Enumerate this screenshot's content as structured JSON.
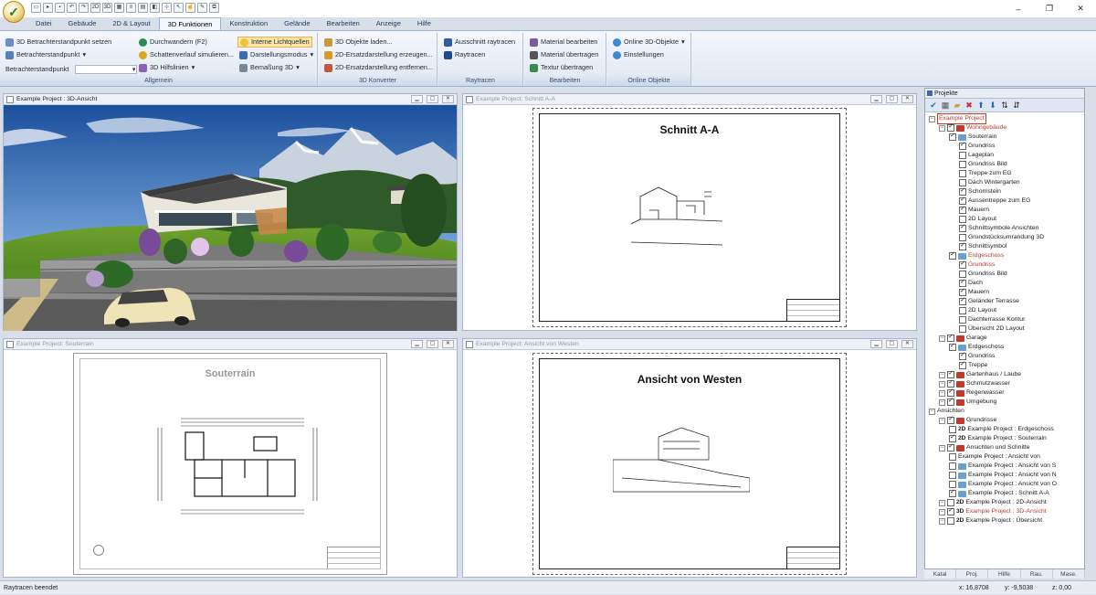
{
  "app": {
    "icon": "app-orb-icon"
  },
  "window_controls": [
    "–",
    "❐",
    "✕"
  ],
  "tabs": [
    "Datei",
    "Gebäude",
    "2D & Layout",
    "3D Funktionen",
    "Konstruktion",
    "Gelände",
    "Bearbeiten",
    "Anzeige",
    "Hilfe"
  ],
  "active_tab": "3D Funktionen",
  "ribbon": {
    "allgemein": {
      "label": "Allgemein",
      "col1": [
        "3D Betrachterstandpunkt setzen",
        "Betrachterstandpunkt",
        "Betrachterstandpunkt"
      ],
      "col2": [
        "Durchwandern (F2)",
        "Schattenverlauf simulieren...",
        "3D Hilfslinien"
      ],
      "col3": [
        "Interne Lichtquellen",
        "Darstellungsmodus",
        "Bemaßung 3D"
      ]
    },
    "konverter": {
      "label": "3D Konverter",
      "items": [
        "3D Objekte laden...",
        "2D-Ersatzdarstellung erzeugen...",
        "2D-Ersatzdarstellung entfernen..."
      ]
    },
    "raytracen": {
      "label": "Raytracen",
      "items": [
        "Ausschnitt raytracen",
        "Raytracen"
      ]
    },
    "bearbeiten": {
      "label": "Bearbeiten",
      "items": [
        "Material bearbeiten",
        "Material übertragen",
        "Textur übertragen"
      ]
    },
    "online": {
      "label": "Online Objekte",
      "items": [
        "Online 3D-Objekte",
        "Einstellungen"
      ]
    }
  },
  "windows": {
    "view3d": {
      "title": "Example Project : 3D-Ansicht"
    },
    "schnitt": {
      "title": "Example Project: Schnitt A-A",
      "sheet_title": "Schnitt A-A"
    },
    "souterrain": {
      "title": "Example Project: Souterrain",
      "sheet_title": "Souterrain"
    },
    "westen": {
      "title": "Example Project: Ansicht von Westen",
      "sheet_title": "Ansicht von Westen"
    }
  },
  "projects": {
    "header": "Projekte",
    "nodes": [
      {
        "label": "Example Project",
        "level": 0,
        "red": true,
        "box": true
      },
      {
        "label": "Wohngebäude",
        "level": 1,
        "red": true,
        "check": true
      },
      {
        "label": "Souterrain",
        "level": 2,
        "check": true
      },
      {
        "label": "Grundriss",
        "level": 3,
        "check": true
      },
      {
        "label": "Lageplan",
        "level": 3,
        "check": false
      },
      {
        "label": "Grundriss Bild",
        "level": 3,
        "check": false
      },
      {
        "label": "Treppe zum EG",
        "level": 3,
        "check": false
      },
      {
        "label": "Dach Wintergarten",
        "level": 3,
        "check": false
      },
      {
        "label": "Schornstein",
        "level": 3,
        "check": true
      },
      {
        "label": "Aussentreppe zum EG",
        "level": 3,
        "check": true
      },
      {
        "label": "Mauern",
        "level": 3,
        "check": true
      },
      {
        "label": "2D Layout",
        "level": 3,
        "check": false
      },
      {
        "label": "Schnittsymbole Ansichten",
        "level": 3,
        "check": true
      },
      {
        "label": "Grundstücksumrandung 3D",
        "level": 3,
        "check": false
      },
      {
        "label": "Schnittsymbol",
        "level": 3,
        "check": true
      },
      {
        "label": "Erdgeschoss",
        "level": 2,
        "check": true,
        "red": true
      },
      {
        "label": "Grundriss",
        "level": 3,
        "check": true,
        "red": true
      },
      {
        "label": "Grundriss Bild",
        "level": 3,
        "check": false
      },
      {
        "label": "Dach",
        "level": 3,
        "check": true
      },
      {
        "label": "Mauern",
        "level": 3,
        "check": true
      },
      {
        "label": "Geländer Terrasse",
        "level": 3,
        "check": true
      },
      {
        "label": "2D Layout",
        "level": 3,
        "check": false
      },
      {
        "label": "Dachterrasse Kontur",
        "level": 3,
        "check": false
      },
      {
        "label": "Übersicht 2D Layout",
        "level": 3,
        "check": false
      },
      {
        "label": "Garage",
        "level": 1,
        "check": true
      },
      {
        "label": "Erdgeschoss",
        "level": 2,
        "check": true
      },
      {
        "label": "Grundriss",
        "level": 3,
        "check": true
      },
      {
        "label": "Treppe",
        "level": 3,
        "check": true
      },
      {
        "label": "Gartenhaus / Laube",
        "level": 1,
        "check": true
      },
      {
        "label": "Schmutzwasser",
        "level": 1,
        "check": true
      },
      {
        "label": "Regenwasser",
        "level": 1,
        "check": true
      },
      {
        "label": "Umgebung",
        "level": 1,
        "check": true
      },
      {
        "label": "Ansichten",
        "level": 0,
        "check": null
      },
      {
        "label": "Grundrisse",
        "level": 1,
        "check": true
      },
      {
        "label": "Example Project : Erdgeschoss",
        "level": 2,
        "check": false,
        "tag": "2D"
      },
      {
        "label": "Example Project : Souterrain",
        "level": 2,
        "check": true,
        "tag": "2D"
      },
      {
        "label": "Ansichten und Schnitte",
        "level": 1,
        "check": true
      },
      {
        "label": "Example Project : Ansicht von",
        "level": 2,
        "check": false
      },
      {
        "label": "Example Project : Ansicht von S",
        "level": 2,
        "check": false
      },
      {
        "label": "Example Project : Ansicht von N",
        "level": 2,
        "check": false
      },
      {
        "label": "Example Project : Ansicht von O",
        "level": 2,
        "check": false
      },
      {
        "label": "Example Project : Schnitt A-A",
        "level": 2,
        "check": true
      },
      {
        "label": "Example Project : 2D-Ansicht",
        "level": 1,
        "check": false,
        "tag": "2D"
      },
      {
        "label": "Example Project : 3D-Ansicht",
        "level": 1,
        "check": true,
        "tag": "3D",
        "red": true
      },
      {
        "label": "Example Project : Übersicht",
        "level": 1,
        "check": false,
        "tag": "2D"
      }
    ],
    "bottom_tabs": [
      "Katal",
      "Proj.",
      "Hilfe",
      "Rau.",
      "Mase."
    ]
  },
  "status": {
    "text": "Raytracen beendet",
    "x": "x: 16,8708",
    "y": "y: -9,5038",
    "z": "z: 0,00"
  }
}
